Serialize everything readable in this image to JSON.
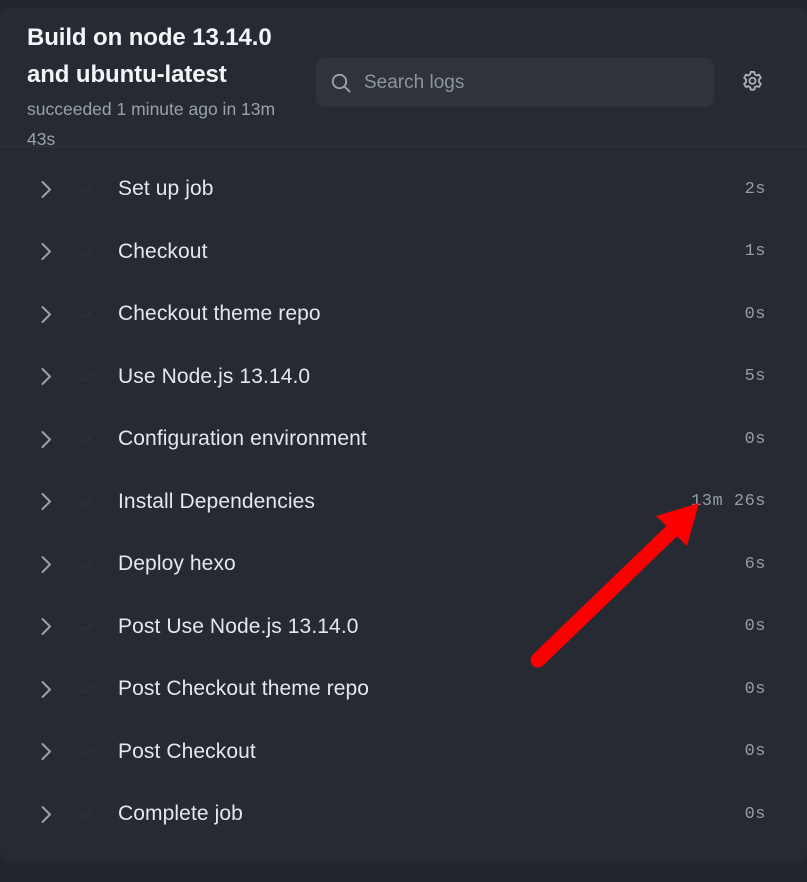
{
  "header": {
    "title": "Build on node 13.14.0 and ubuntu-latest",
    "status_text": "succeeded 1 minute ago in 13m 43s",
    "search_placeholder": "Search logs",
    "search_value": "",
    "search_icon": "search-icon",
    "settings_icon": "gear-icon"
  },
  "steps": [
    {
      "label": "Set up job",
      "duration": "2s",
      "status": "succeeded",
      "expand_icon": "chevron-right-icon",
      "status_icon": "check-circle-icon"
    },
    {
      "label": "Checkout",
      "duration": "1s",
      "status": "succeeded",
      "expand_icon": "chevron-right-icon",
      "status_icon": "check-circle-icon"
    },
    {
      "label": "Checkout theme repo",
      "duration": "0s",
      "status": "succeeded",
      "expand_icon": "chevron-right-icon",
      "status_icon": "check-circle-icon"
    },
    {
      "label": "Use Node.js 13.14.0",
      "duration": "5s",
      "status": "succeeded",
      "expand_icon": "chevron-right-icon",
      "status_icon": "check-circle-icon"
    },
    {
      "label": "Configuration environment",
      "duration": "0s",
      "status": "succeeded",
      "expand_icon": "chevron-right-icon",
      "status_icon": "check-circle-icon"
    },
    {
      "label": "Install Dependencies",
      "duration": "13m 26s",
      "status": "succeeded",
      "expand_icon": "chevron-right-icon",
      "status_icon": "check-circle-icon"
    },
    {
      "label": "Deploy hexo",
      "duration": "6s",
      "status": "succeeded",
      "expand_icon": "chevron-right-icon",
      "status_icon": "check-circle-icon"
    },
    {
      "label": "Post Use Node.js 13.14.0",
      "duration": "0s",
      "status": "succeeded",
      "expand_icon": "chevron-right-icon",
      "status_icon": "check-circle-icon"
    },
    {
      "label": "Post Checkout theme repo",
      "duration": "0s",
      "status": "succeeded",
      "expand_icon": "chevron-right-icon",
      "status_icon": "check-circle-icon"
    },
    {
      "label": "Post Checkout",
      "duration": "0s",
      "status": "succeeded",
      "expand_icon": "chevron-right-icon",
      "status_icon": "check-circle-icon"
    },
    {
      "label": "Complete job",
      "duration": "0s",
      "status": "succeeded",
      "expand_icon": "chevron-right-icon",
      "status_icon": "check-circle-icon"
    }
  ],
  "annotation": {
    "type": "arrow",
    "color": "#fa0000",
    "points_at": "Install Dependencies duration"
  },
  "colors": {
    "page_background": "#22252c",
    "panel_background": "#262a33",
    "search_background": "#2f333c",
    "title_text": "#f3f5f7",
    "muted_text": "#959ca6",
    "step_label_text": "#e4e7eb",
    "status_disc": "#9199a5",
    "divider": "#2f333c",
    "annotation": "#fa0000"
  }
}
